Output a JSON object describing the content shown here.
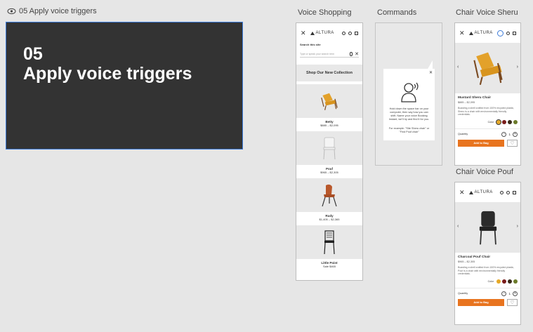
{
  "header": {
    "title": "05 Apply voice triggers"
  },
  "hero": {
    "number": "05",
    "title": "Apply voice triggers"
  },
  "columns": {
    "voice_shopping": "Voice Shopping",
    "commands": "Commands",
    "chair_sheru": "Chair Voice Sheru",
    "chair_pouf": "Chair Voice Pouf"
  },
  "brand": "ALTURA",
  "voice_shopping": {
    "search_label": "Search this site",
    "search_placeholder": "Type or speak your search term",
    "collection_title": "Shop Our New Collection",
    "products": [
      {
        "name": "Betty",
        "price": "$885 – $2,095"
      },
      {
        "name": "Pouf",
        "price": "$965 – $2,305"
      },
      {
        "name": "Rudy",
        "price": "$1,405 – $2,365"
      },
      {
        "name": "Little Point",
        "price": "Sale $465"
      }
    ]
  },
  "commands": {
    "text": "Hold down the space bar on your computer, then say how you can shift. Name your voice Booking Instant, we'll try and find it for you.",
    "example": "For example: \"Site Sheru chair\" or \"Find Pouf chair\""
  },
  "sheru": {
    "name": "Mustard Sheru Chair",
    "price": "$885 – $2,095",
    "desc": "Boasting a shell crafted from 100% recycled plastic, Sheru is a chair with environmentally friendly credentials.",
    "color_label": "Color",
    "colors": [
      "#e5a826",
      "#7a1c1c",
      "#3a2a1a",
      "#6b7a2a"
    ],
    "qty_label": "Quantity",
    "qty": "1",
    "add_label": "Add to Bag"
  },
  "pouf": {
    "name": "Charcoal Pouf Chair",
    "price": "$965 – $2,305",
    "desc": "Boasting a shell crafted from 100% recycled plastic, Pouf is a chair with environmentally friendly credentials.",
    "color_label": "Color",
    "colors": [
      "#e5a826",
      "#7a1c1c",
      "#3a2a1a",
      "#6b7a2a"
    ],
    "qty_label": "Quantity",
    "qty": "1",
    "add_label": "Add to Bag"
  }
}
